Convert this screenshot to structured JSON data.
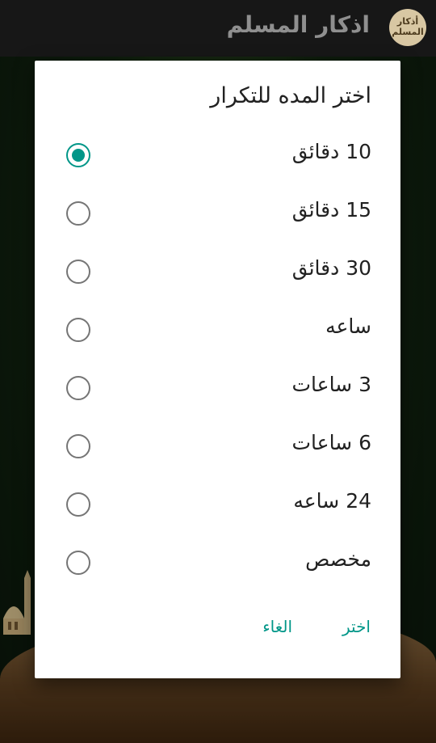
{
  "app": {
    "title": "اذكار المسلم",
    "logo_text": "أذكار المسلم"
  },
  "dialog": {
    "title": "اختر المده للتكرار",
    "options": [
      {
        "label": "10 دقائق",
        "selected": true
      },
      {
        "label": "15 دقائق",
        "selected": false
      },
      {
        "label": "30 دقائق",
        "selected": false
      },
      {
        "label": "ساعه",
        "selected": false
      },
      {
        "label": "3 ساعات",
        "selected": false
      },
      {
        "label": "6 ساعات",
        "selected": false
      },
      {
        "label": "24 ساعه",
        "selected": false
      },
      {
        "label": "مخصص",
        "selected": false
      }
    ],
    "choose_label": "اختر",
    "cancel_label": "الغاء"
  },
  "colors": {
    "accent": "#009688",
    "appbar": "#171717"
  }
}
